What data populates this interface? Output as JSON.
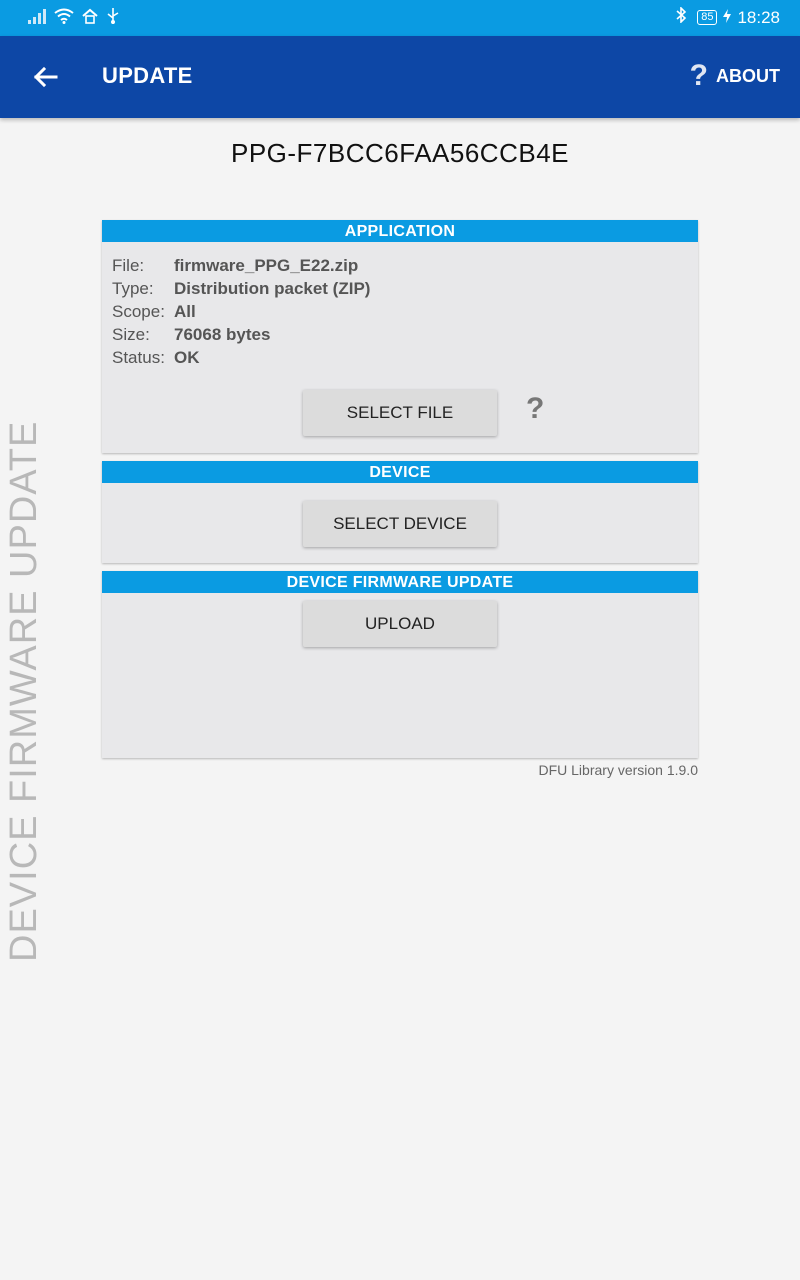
{
  "status_bar": {
    "time": "18:28",
    "battery": "85",
    "icons": [
      "signal-icon",
      "wifi-icon",
      "home-network-icon",
      "usb-icon",
      "bluetooth-icon",
      "battery-icon",
      "charging-icon"
    ]
  },
  "app_bar": {
    "title": "UPDATE",
    "about_label": "ABOUT",
    "about_icon": "?"
  },
  "device_name": "PPG-F7BCC6FAA56CCB4E",
  "side_label": "DEVICE FIRMWARE UPDATE",
  "application": {
    "header": "APPLICATION",
    "info": [
      {
        "key": "File:",
        "value": "firmware_PPG_E22.zip"
      },
      {
        "key": "Type:",
        "value": "Distribution packet (ZIP)"
      },
      {
        "key": "Scope:",
        "value": "All"
      },
      {
        "key": "Size:",
        "value": "76068 bytes"
      },
      {
        "key": "Status:",
        "value": "OK"
      }
    ],
    "select_file_label": "SELECT FILE",
    "help_label": "?"
  },
  "device": {
    "header": "DEVICE",
    "select_device_label": "SELECT DEVICE"
  },
  "dfu": {
    "header": "DEVICE FIRMWARE UPDATE",
    "upload_label": "UPLOAD"
  },
  "version": "DFU Library version 1.9.0",
  "colors": {
    "status_bar": "#0a9be2",
    "app_bar": "#0d47a6",
    "section_header": "#0a9be2",
    "background": "#f4f4f4"
  }
}
